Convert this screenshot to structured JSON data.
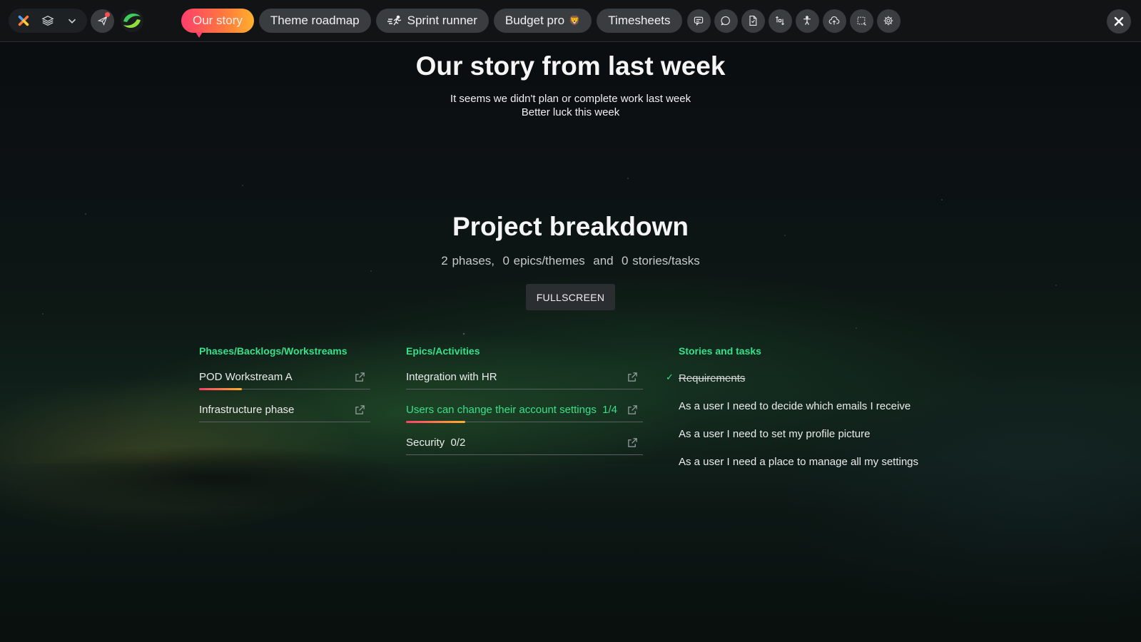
{
  "topbar": {
    "tabs": [
      {
        "label": "Our story"
      },
      {
        "label": "Theme roadmap"
      },
      {
        "label": "Sprint runner"
      },
      {
        "label": "Budget pro",
        "emoji": "🦁"
      },
      {
        "label": "Timesheets"
      }
    ],
    "icons": [
      "chat-icon",
      "comment-icon",
      "document-icon",
      "sync-icon",
      "accessibility-icon",
      "cloud-upload-icon",
      "selection-icon",
      "settings-icon"
    ]
  },
  "hero": {
    "title": "Our story from last week",
    "line1": "It seems we didn't plan or complete work last week",
    "line2": "Better luck this week"
  },
  "breakdown": {
    "title": "Project breakdown",
    "summary": "2 phases,  0 epics/themes  and  0 stories/tasks",
    "fullscreen_label": "FULLSCREEN"
  },
  "columns": {
    "phases": {
      "heading": "Phases/Backlogs/Workstreams",
      "items": [
        {
          "label": "POD Workstream A",
          "progress": 0.25
        },
        {
          "label": "Infrastructure phase",
          "progress": 0
        }
      ]
    },
    "epics": {
      "heading": "Epics/Activities",
      "items": [
        {
          "label": "Integration with HR",
          "count": ""
        },
        {
          "label": "Users can change their account settings",
          "count": "1/4",
          "progress": 0.25
        },
        {
          "label": "Security",
          "count": "0/2"
        }
      ]
    },
    "stories": {
      "heading": "Stories and tasks",
      "items": [
        {
          "label": "Requirements",
          "done": true
        },
        {
          "label": "As a user I need to decide which emails I receive",
          "done": false
        },
        {
          "label": "As a user I need to set my profile picture",
          "done": false
        },
        {
          "label": "As a user I need a place to manage all my settings",
          "done": false
        }
      ]
    }
  },
  "colors": {
    "accent_green": "#38e08a",
    "active_tab_start": "#ff3e6c",
    "active_tab_end": "#ffb02e"
  }
}
